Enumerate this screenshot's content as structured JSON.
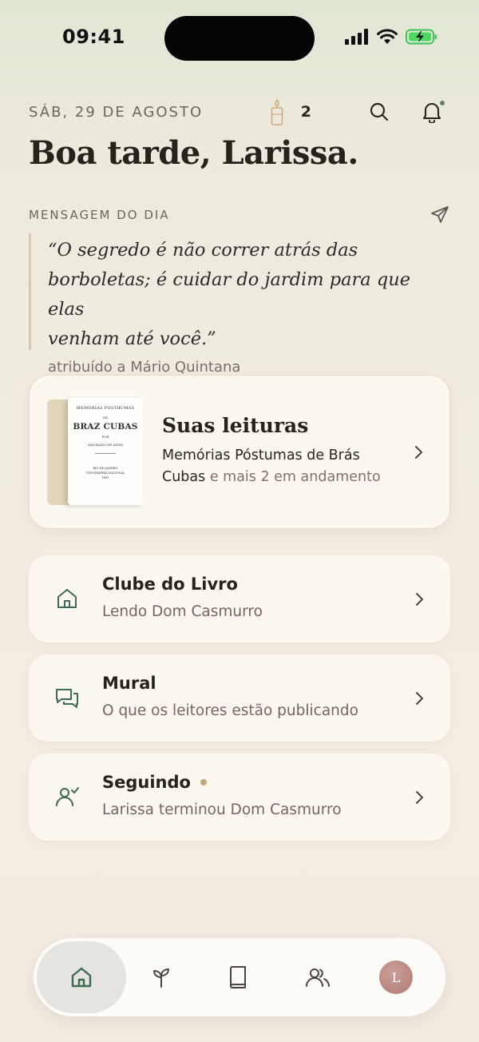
{
  "status_bar": {
    "time": "09:41"
  },
  "header": {
    "date": "SÁB, 29 DE AGOSTO",
    "candle_count": "2",
    "greeting": "Boa tarde, Larissa."
  },
  "message": {
    "label": "MENSAGEM DO DIA",
    "quote_lines": [
      "“O segredo é não correr atrás das",
      "borboletas; é cuidar do jardim para que elas",
      "venham até você.”"
    ],
    "attribution": "atribuído a Mário Quintana"
  },
  "reading": {
    "title": "Suas leituras",
    "book_title": "Memórias Póstumas de Brás Cubas",
    "more": " e mais 2 em andamento",
    "cover": {
      "top": "MEMORIAS POSTHUMAS",
      "de": "DE",
      "name": "BRAZ CUBAS",
      "por": "POR",
      "author": "MACHADO DE ASSIS",
      "city": "RIO DE JANEIRO",
      "publisher": "TYPOGRAPHIA NACIONAL",
      "year": "1881"
    }
  },
  "list": [
    {
      "title": "Clube do Livro",
      "subtitle": "Lendo Dom Casmurro",
      "icon": "home-icon"
    },
    {
      "title": "Mural",
      "subtitle": "O que os leitores estão publicando",
      "icon": "chat-icon"
    },
    {
      "title": "Seguindo",
      "subtitle": "Larissa terminou Dom Casmurro",
      "icon": "user-check-icon",
      "badge": true
    }
  ],
  "tabbar": {
    "tabs": [
      "home-icon",
      "sprout-icon",
      "book-icon",
      "users-icon",
      "avatar"
    ],
    "active": "home-icon",
    "avatar_initial": "L"
  },
  "colors": {
    "accent_green": "#3d6b52",
    "badge": "#c2a77f",
    "avatar": "#b8867d"
  }
}
